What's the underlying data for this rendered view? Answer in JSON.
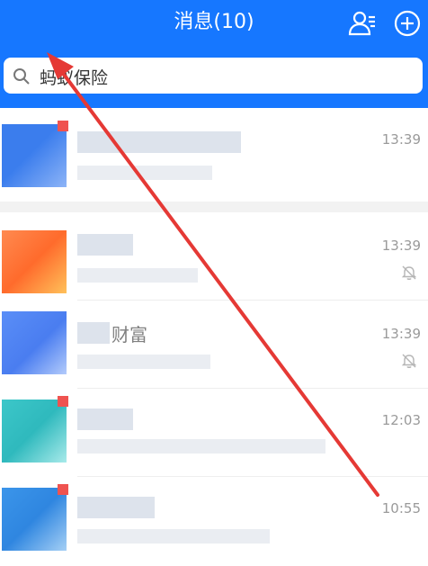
{
  "header": {
    "title": "消息(10)"
  },
  "search": {
    "value": "蚂蚁保险"
  },
  "conversations": [
    {
      "time": "13:39",
      "muted": false,
      "unread": true,
      "avatar_colors": [
        "#3b7ded",
        "#7aa8f5"
      ]
    },
    {
      "time": "13:39",
      "muted": true,
      "unread": false,
      "avatar_colors": [
        "#ff7a3d",
        "#ffb547"
      ]
    },
    {
      "time": "13:39",
      "muted": true,
      "unread": false,
      "avatar_colors": [
        "#5a8ef7",
        "#a9c3fb"
      ]
    },
    {
      "time": "12:03",
      "muted": false,
      "unread": true,
      "avatar_colors": [
        "#3cc7c9",
        "#9be5e5"
      ]
    },
    {
      "time": "10:55",
      "muted": false,
      "unread": true,
      "avatar_colors": [
        "#3b95ea",
        "#9ccaf5"
      ]
    }
  ],
  "partial_name_text": "财富",
  "colors": {
    "brand": "#1677ff",
    "annotation_arrow": "#e53935",
    "unread_dot": "#ef5350"
  },
  "icons": [
    "add-contact-icon",
    "plus-circle-icon",
    "search-icon",
    "bell-muted-icon"
  ]
}
